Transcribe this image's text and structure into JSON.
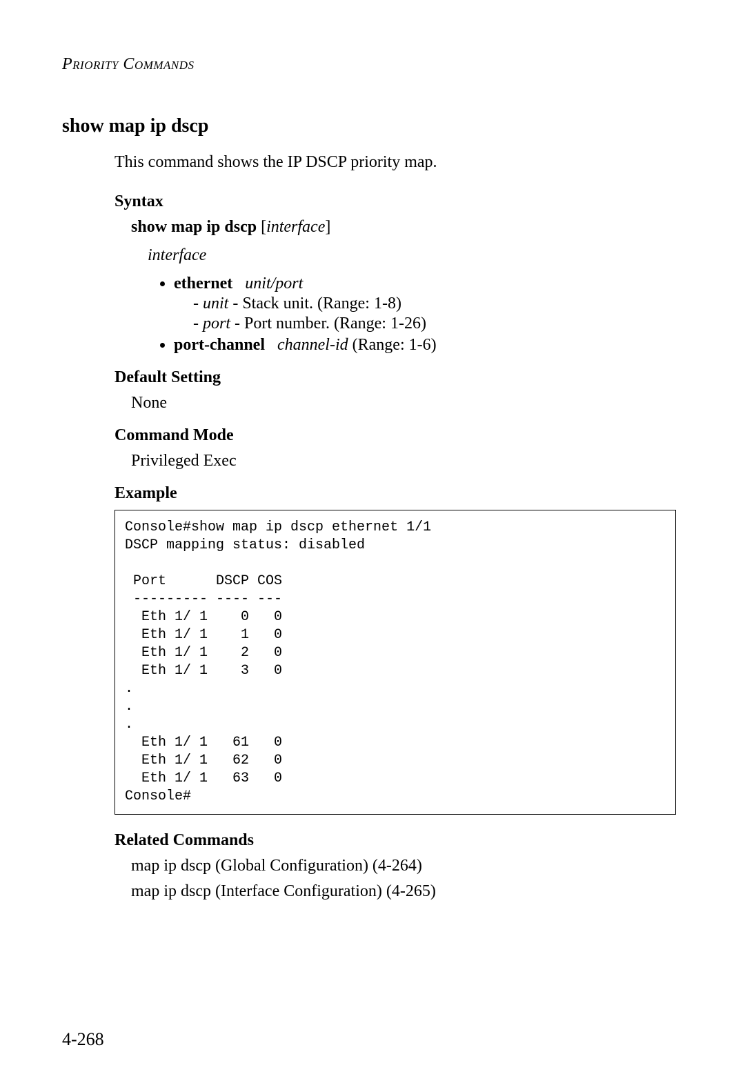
{
  "running_head": "Priority Commands",
  "title": "show map ip dscp",
  "description": "This command shows the IP DSCP priority map.",
  "syntax": {
    "heading": "Syntax",
    "line_bold": "show map ip dscp",
    "line_tail_open": " [",
    "line_tail_param": "interface",
    "line_tail_close": "]",
    "interface_label": "interface",
    "ethernet_kw": "ethernet",
    "ethernet_args": "unit/port",
    "unit_param": "unit",
    "unit_desc": " - Stack unit. (Range: 1-8)",
    "port_param": "port",
    "port_desc": " - Port number. (Range: 1-26)",
    "portchannel_kw": "port-channel",
    "portchannel_arg": "channel-id",
    "portchannel_tail": " (Range: 1-6)"
  },
  "default": {
    "heading": "Default Setting",
    "value": "None"
  },
  "mode": {
    "heading": "Command Mode",
    "value": "Privileged Exec"
  },
  "example": {
    "heading": "Example",
    "code": "Console#show map ip dscp ethernet 1/1\nDSCP mapping status: disabled\n\n Port      DSCP COS\n --------- ---- ---\n  Eth 1/ 1    0   0\n  Eth 1/ 1    1   0\n  Eth 1/ 1    2   0\n  Eth 1/ 1    3   0\n.\n.\n.\n  Eth 1/ 1   61   0\n  Eth 1/ 1   62   0\n  Eth 1/ 1   63   0\nConsole#"
  },
  "related": {
    "heading": "Related Commands",
    "lines": [
      "map ip dscp (Global Configuration) (4-264)",
      "map ip dscp (Interface Configuration) (4-265)"
    ]
  },
  "page_number": "4-268"
}
